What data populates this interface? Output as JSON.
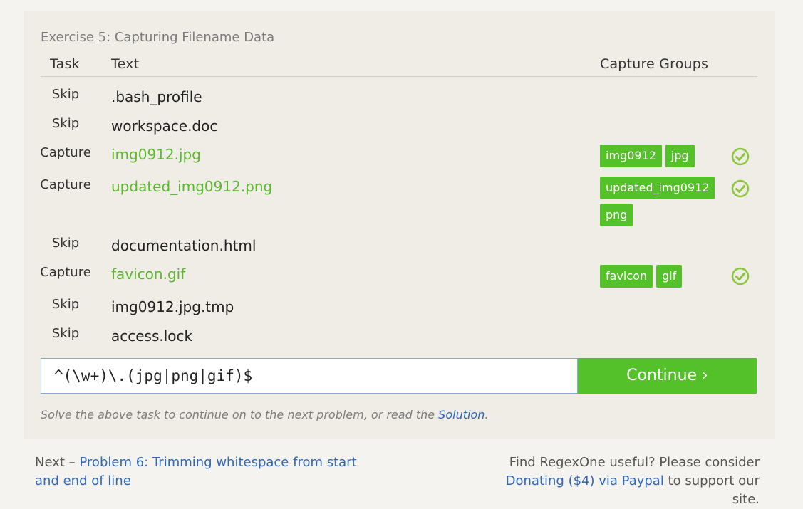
{
  "exercise_title": "Exercise 5: Capturing Filename Data",
  "headers": {
    "task": "Task",
    "text": "Text",
    "groups": "Capture Groups"
  },
  "rows": [
    {
      "task": "Skip",
      "text": ".bash_profile",
      "groups": [],
      "solved": false
    },
    {
      "task": "Skip",
      "text": "workspace.doc",
      "groups": [],
      "solved": false
    },
    {
      "task": "Capture",
      "text": "img0912.jpg",
      "groups": [
        "img0912",
        "jpg"
      ],
      "solved": true
    },
    {
      "task": "Capture",
      "text": "updated_img0912.png",
      "groups": [
        "updated_img0912",
        "png"
      ],
      "solved": true
    },
    {
      "task": "Skip",
      "text": "documentation.html",
      "groups": [],
      "solved": false
    },
    {
      "task": "Capture",
      "text": "favicon.gif",
      "groups": [
        "favicon",
        "gif"
      ],
      "solved": true
    },
    {
      "task": "Skip",
      "text": "img0912.jpg.tmp",
      "groups": [],
      "solved": false
    },
    {
      "task": "Skip",
      "text": "access.lock",
      "groups": [],
      "solved": false
    }
  ],
  "regex_value": "^(\\w+)\\.(jpg|png|gif)$",
  "continue_label": "Continue ›",
  "hint": {
    "prefix": "Solve the above task to continue on to the next problem, or read the ",
    "link": "Solution",
    "suffix": "."
  },
  "footer": {
    "next_prefix": "Next – ",
    "next_link": "Problem 6: Trimming whitespace from start and end of line",
    "donate_prefix": "Find RegexOne useful? Please consider ",
    "donate_link": "Donating ($4) via Paypal",
    "donate_suffix": " to support our site."
  },
  "colors": {
    "accent_green": "#55c12a",
    "capture_text": "#5cb82e",
    "link_blue": "#2f67b9",
    "check_green": "#8cc63f"
  },
  "icons": {
    "solved": "check-circle-icon"
  }
}
